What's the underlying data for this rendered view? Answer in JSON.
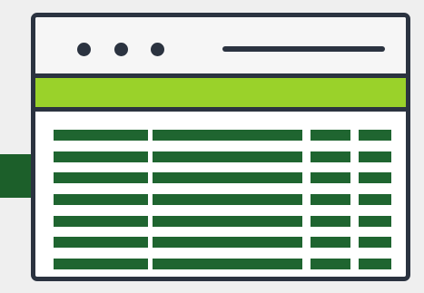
{
  "colors": {
    "background": "#efefef",
    "frame": "#2b3340",
    "header_band": "#9ad22a",
    "table_bars": "#1f6530",
    "side_accent": "#1c5f2a",
    "window_body": "#ffffff"
  },
  "icons": {
    "window_controls": [
      "window-dot-icon",
      "window-dot-icon",
      "window-dot-icon"
    ],
    "address_bar": "address-bar-line-icon"
  },
  "table": {
    "columns": 4,
    "rows": 7
  }
}
